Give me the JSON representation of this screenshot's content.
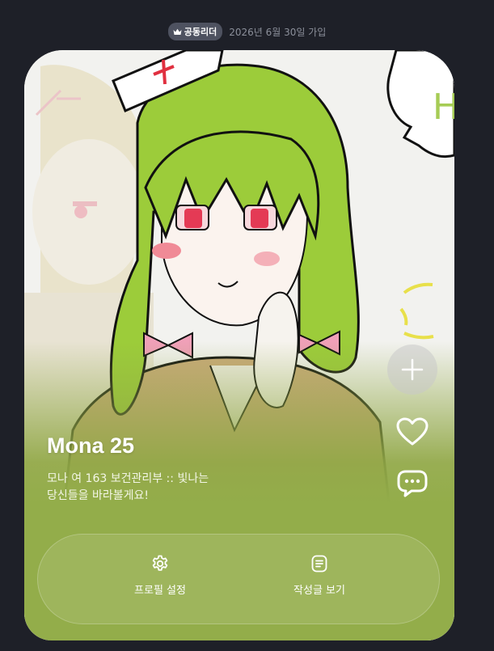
{
  "header": {
    "role_badge": "공동리더",
    "join_date": "2026년 6월 30일 가입"
  },
  "profile": {
    "name": "Mona 25",
    "bio_line1": "모나 여 163 보건관리부 :: 빛나는",
    "bio_line2": "당신들을 바라볼게요!"
  },
  "side_actions": [
    {
      "label": "",
      "icon": "plus-icon"
    },
    {
      "label": "",
      "icon": "heart-icon"
    },
    {
      "label": "",
      "icon": "chat-bubble-icon"
    }
  ],
  "actions": {
    "settings_label": "프로필 설정",
    "posts_label": "작성글 보기"
  },
  "artwork_text": "H",
  "colors": {
    "background": "#1e2028",
    "card_green": "#93ad4a",
    "hair_green": "#9ccc3a",
    "eye_red": "#e43a55",
    "bow_pink": "#f0a0b8",
    "badge_bg": "#4e5260"
  }
}
